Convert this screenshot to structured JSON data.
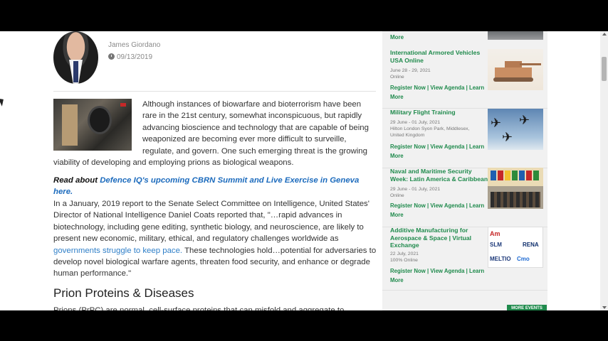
{
  "author": {
    "name": "James Giordano",
    "date": "09/13/2019"
  },
  "article": {
    "intro": "Although instances of biowarfare and bioterrorism have been rare in the 21st century, somewhat inconspicuous, but rapidly advancing bioscience and technology that are capable of being weaponized are becoming ever more difficult to surveille, regulate, and govern. One such emerging threat is the growing viability of developing and employing prions as biological weapons.",
    "read_about_lead": "Read about",
    "read_about_link": "Defence IQ's upcoming CBRN Summit and Live Exercise in Geneva here.",
    "para2_part1": "In a January, 2019 report to the Senate Select Committee on Intelligence, United States' Director of National Intelligence Daniel Coats reported that, \"…rapid advances in biotechnology, including gene editing, synthetic biology, and neuroscience, are likely to present new economic, military, ethical, and regulatory challenges worldwide as",
    "para2_link": "governments struggle to keep pace.",
    "para2_part2": "These technologies hold…potential for adversaries to develop novel biological warfare agents, threaten food security, and enhance or degrade human performance.\"",
    "heading": "Prion Proteins & Diseases",
    "para3": "Prions (PrPC) are normal, cell-surface proteins that can misfold and aggregate to"
  },
  "sidebar": {
    "top_more": "More",
    "events": [
      {
        "title": "International Armored Vehicles USA Online",
        "date": "June 28 - 29, 2021",
        "location": "Online",
        "location2": "",
        "links": "Register Now | View Agenda | Learn More",
        "image": "tank-image"
      },
      {
        "title": "Military Flight Training",
        "date": "29 June - 01 July, 2021",
        "location": "Hilton London Syon Park, Middlesex,",
        "location2": "United Kingdom",
        "links": "Register Now | View Agenda | Learn More",
        "image": "jets-image"
      },
      {
        "title": "Naval and Maritime Security Week: Latin America & Caribbean",
        "date": "29 June - 01 July, 2021",
        "location": "Online",
        "location2": "",
        "links": "Register Now | View Agenda | Learn More",
        "image": "flags-image"
      },
      {
        "title": "Additive Manufacturing for Aerospace & Space | Virtual Exchange",
        "date": "22 July, 2021",
        "location": "100% Online",
        "location2": "",
        "links": "Register Now | View Agenda | Learn More",
        "image": "am-logos-image"
      }
    ],
    "am_logo": {
      "t1": "Am",
      "t2": "SLM",
      "t3": "MELTIO",
      "t4": "RENA",
      "t5": "Cmo"
    },
    "more_events": "MORE EVENTS"
  },
  "colors": {
    "link_green": "#1f8a4c",
    "link_blue": "#1c6bbd",
    "sidebar_bg": "#f1f1f1"
  }
}
